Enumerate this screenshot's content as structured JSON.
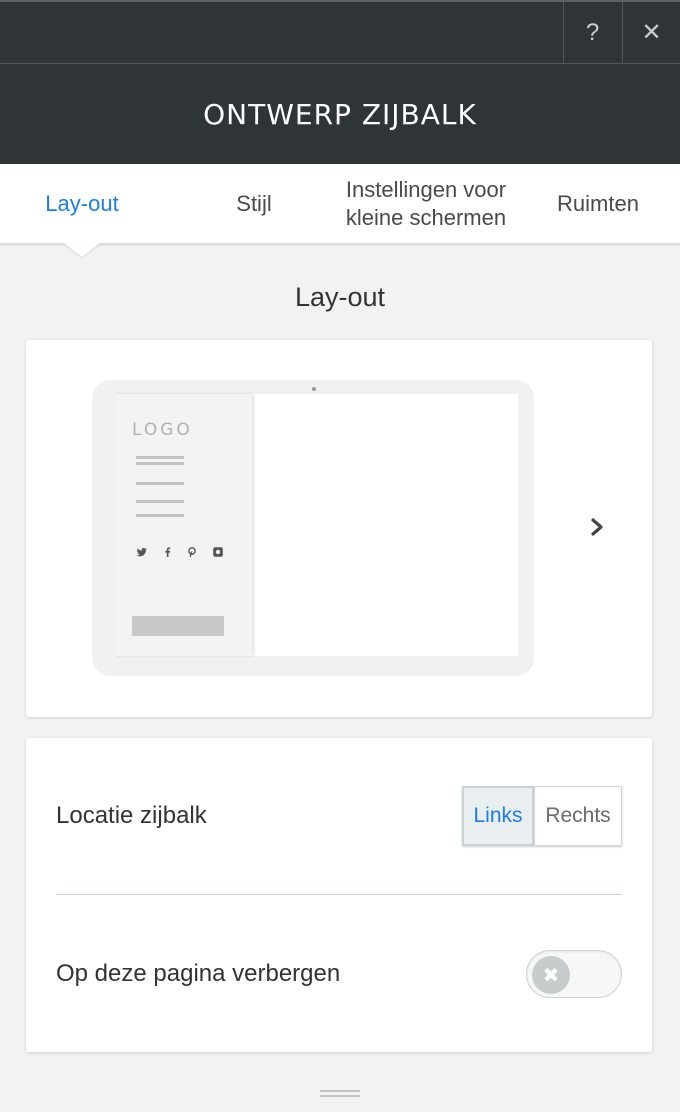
{
  "header": {
    "title": "ONTWERP ZIJBALK",
    "help_label": "?",
    "close_label": "✕"
  },
  "tabs": [
    {
      "label": "Lay-out",
      "active": true
    },
    {
      "label": "Stijl",
      "active": false
    },
    {
      "label": "Instellingen voor kleine schermen",
      "active": false
    },
    {
      "label": "Ruimten",
      "active": false
    }
  ],
  "section_title": "Lay-out",
  "preview": {
    "logo_text": "LOGO",
    "social_icons": [
      "twitter-icon",
      "facebook-icon",
      "pinterest-icon",
      "instagram-icon"
    ],
    "next_icon": "chevron-right-icon"
  },
  "settings": {
    "location_label": "Locatie zijbalk",
    "location_options": [
      "Links",
      "Rechts"
    ],
    "location_selected": "Links",
    "hide_label": "Op deze pagina verbergen",
    "hide_enabled": false,
    "toggle_icon": "✖"
  },
  "colors": {
    "accent": "#1f7de0",
    "header_bg": "#2f3437",
    "page_bg": "#f2f2f2"
  }
}
